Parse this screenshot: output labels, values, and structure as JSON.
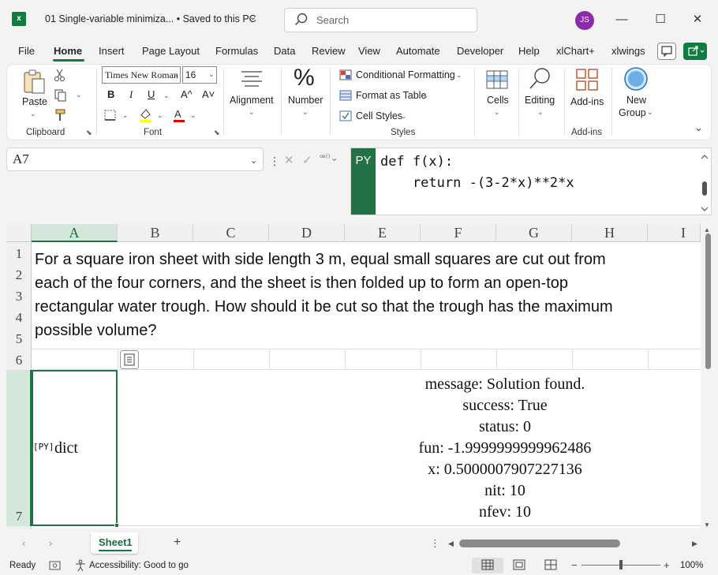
{
  "titlebar": {
    "app_icon_letter": "x",
    "doc_title": "01 Single-variable minimiza... • Saved to this PC",
    "search_placeholder": "Search",
    "avatar_initials": "JS",
    "minimize_glyph": "—",
    "maximize_glyph": "☐",
    "close_glyph": "✕"
  },
  "menu": {
    "tabs": [
      "File",
      "Home",
      "Insert",
      "Page Layout",
      "Formulas",
      "Data",
      "Review",
      "View",
      "Automate",
      "Developer",
      "Help",
      "xlChart+",
      "xlwings"
    ],
    "active_tab": "Home"
  },
  "ribbon": {
    "paste_label": "Paste",
    "clipboard_label": "Clipboard",
    "font_name": "Times New Roman",
    "font_size": "16",
    "font_label": "Font",
    "bold": "B",
    "italic": "I",
    "underline": "U",
    "grow_font": "A^",
    "shrink_font": "A˅",
    "alignment_label": "Alignment",
    "number_label": "Number",
    "number_glyph": "%",
    "conditional_formatting": "Conditional Formatting",
    "format_as_table": "Format as Table",
    "cell_styles": "Cell Styles",
    "styles_label": "Styles",
    "cells_label": "Cells",
    "editing_label": "Editing",
    "addins_label": "Add-ins",
    "addins_group_label": "Add-ins",
    "new_group_label_1": "New",
    "new_group_label_2": "Group"
  },
  "formula_bar": {
    "name_box": "A7",
    "py_badge": "PY",
    "code_lines": [
      "def f(x):",
      "    return -(3-2*x)**2*x"
    ]
  },
  "grid": {
    "columns": [
      "A",
      "B",
      "C",
      "D",
      "E",
      "F",
      "G",
      "H",
      "I"
    ],
    "rows": [
      "1",
      "2",
      "3",
      "4",
      "5",
      "6",
      "7"
    ],
    "problem_lines": [
      "For a square iron sheet with side length 3 m, equal small squares are cut out from",
      "each of the four corners, and the sheet is then folded up to form an open-top",
      "rectangular water trough. How should it be cut so that the trough has the maximum",
      "possible volume?"
    ],
    "a7_py_tag": "[PY]",
    "a7_value": "dict",
    "result_lines": [
      "message: Solution found.",
      "success: True",
      "status: 0",
      "fun: -1.9999999999962486",
      "x: 0.5000007907227136",
      "nit: 10",
      "nfev: 10"
    ]
  },
  "sheets": {
    "active": "Sheet1",
    "add_glyph": "+"
  },
  "status": {
    "ready": "Ready",
    "accessibility": "Accessibility: Good to go",
    "zoom": "100%",
    "zoom_minus": "−",
    "zoom_plus": "+"
  },
  "colors": {
    "excel_green": "#107c41",
    "selection_green": "#217346",
    "avatar_purple": "#8a2ca9"
  }
}
